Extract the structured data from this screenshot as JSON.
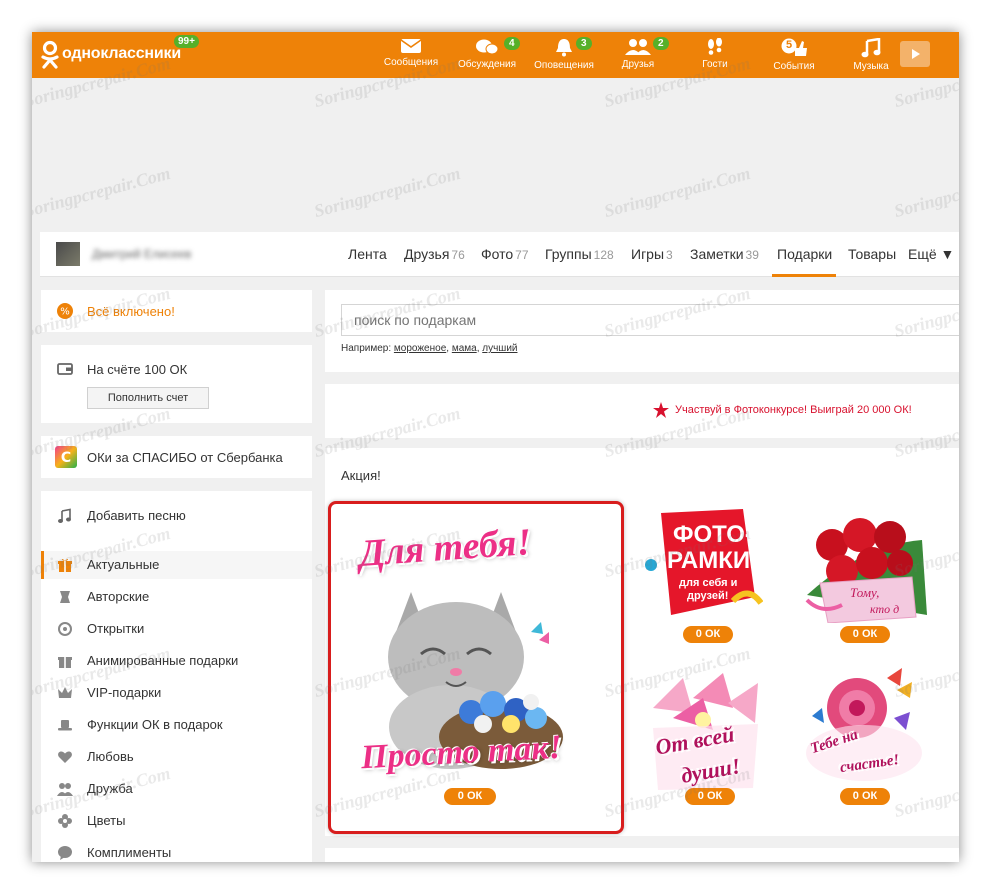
{
  "brand": {
    "name": "одноклассники",
    "badge": "99+"
  },
  "nav": [
    {
      "label": "Сообщения",
      "icon": "envelope-icon",
      "badge": ""
    },
    {
      "label": "Обсуждения",
      "icon": "chat-bubbles-icon",
      "badge": "4"
    },
    {
      "label": "Оповещения",
      "icon": "bell-icon",
      "badge": "3"
    },
    {
      "label": "Друзья",
      "icon": "friends-icon",
      "badge": "2"
    },
    {
      "label": "Гости",
      "icon": "footprints-icon",
      "badge": ""
    },
    {
      "label": "События",
      "icon": "thumbs-up-icon",
      "badge": "5"
    },
    {
      "label": "Музыка",
      "icon": "music-note-icon",
      "badge": ""
    }
  ],
  "profile": {
    "name": "Дмитрий Елисеев",
    "tabs": [
      {
        "label": "Лента",
        "count": ""
      },
      {
        "label": "Друзья",
        "count": "76"
      },
      {
        "label": "Фото",
        "count": "77"
      },
      {
        "label": "Группы",
        "count": "128"
      },
      {
        "label": "Игры",
        "count": "3"
      },
      {
        "label": "Заметки",
        "count": "39"
      },
      {
        "label": "Подарки",
        "count": ""
      },
      {
        "label": "Товары",
        "count": ""
      },
      {
        "label": "Ещё ▼",
        "count": ""
      }
    ]
  },
  "sidebar": {
    "all_inclusive": "Всё включено!",
    "balance": "На счёте 100 ОК",
    "topup_button": "Пополнить счет",
    "sber": "ОКи за СПАСИБО от Сбербанка",
    "add_song": "Добавить песню",
    "categories": [
      {
        "label": "Актуальные",
        "icon": "gift-icon"
      },
      {
        "label": "Авторские",
        "icon": "author-icon"
      },
      {
        "label": "Открытки",
        "icon": "postcard-icon"
      },
      {
        "label": "Анимированные подарки",
        "icon": "animated-gift-icon"
      },
      {
        "label": "VIP-подарки",
        "icon": "crown-icon"
      },
      {
        "label": "Функции ОК в подарок",
        "icon": "hat-icon"
      },
      {
        "label": "Любовь",
        "icon": "heart-icon"
      },
      {
        "label": "Дружба",
        "icon": "friendship-icon"
      },
      {
        "label": "Цветы",
        "icon": "flower-icon"
      },
      {
        "label": "Комплименты",
        "icon": "compliment-icon"
      }
    ]
  },
  "search": {
    "placeholder": "поиск по подаркам",
    "hint_prefix": "Например:",
    "examples": [
      "мороженое",
      "мама",
      "лучший"
    ]
  },
  "contest": "Участвуй в Фотоконкурсе! Выиграй 20 000 ОК!",
  "promo": {
    "title": "Акция!",
    "main_gift": {
      "line1": "Для тебя!",
      "line2": "Просто так!",
      "price": "0 ОК"
    },
    "gifts": [
      {
        "line1": "ФОТО-",
        "line2": "РАМКИ",
        "line3": "для себя и",
        "line4": "друзей!",
        "price": "0 ОК"
      },
      {
        "line1": "Тому,",
        "line2": "кто д",
        "price": "0 ОК"
      },
      {
        "line1": "От всей",
        "line2": "души!",
        "price": "0 ОК"
      },
      {
        "line1": "Тебе на",
        "line2": "счастье!",
        "price": "0 ОК"
      }
    ]
  },
  "watermark": "Soringpcrepair.Com",
  "colors": {
    "accent": "#ee8208",
    "badge": "#56b029",
    "contest_red": "#d8112e",
    "highlight_border": "#d81d1d"
  }
}
